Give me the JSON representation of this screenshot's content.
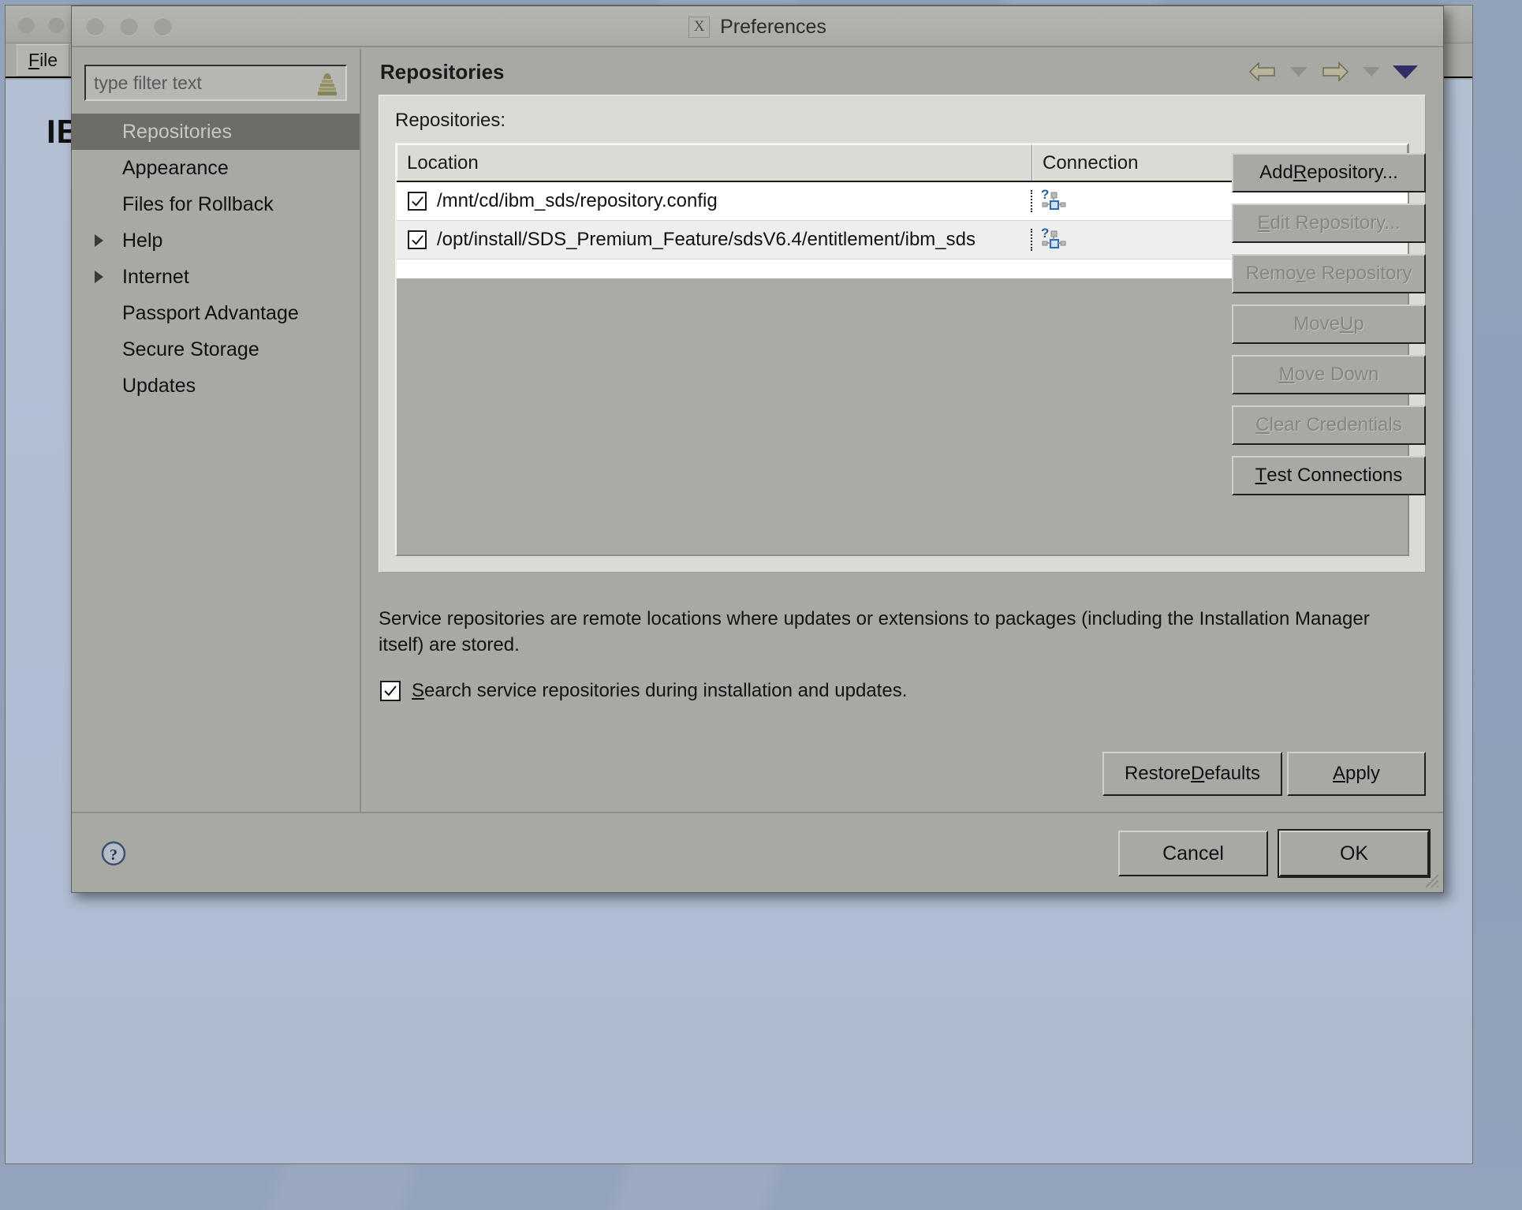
{
  "desktop": {
    "logo_alt": "IBM",
    "background_color": "#8fa0b9"
  },
  "background_window": {
    "menu": [
      {
        "label_before": "F",
        "mnemonic": "i",
        "label_after": "le",
        "full": "File"
      }
    ],
    "app_name": "IBM"
  },
  "dialog": {
    "title": "Preferences",
    "icon": "x-window-icon",
    "window_controls": [
      "close",
      "minimize",
      "maximize"
    ]
  },
  "filter": {
    "placeholder": "type filter text",
    "value": "",
    "icon": "filter-funnel-icon"
  },
  "sidebar": {
    "items": [
      {
        "label": "Repositories",
        "selected": true,
        "expandable": false
      },
      {
        "label": "Appearance",
        "selected": false,
        "expandable": false
      },
      {
        "label": "Files for Rollback",
        "selected": false,
        "expandable": false
      },
      {
        "label": "Help",
        "selected": false,
        "expandable": true
      },
      {
        "label": "Internet",
        "selected": false,
        "expandable": true
      },
      {
        "label": "Passport Advantage",
        "selected": false,
        "expandable": false
      },
      {
        "label": "Secure Storage",
        "selected": false,
        "expandable": false
      },
      {
        "label": "Updates",
        "selected": false,
        "expandable": false
      }
    ]
  },
  "panel": {
    "title": "Repositories",
    "toolbar": [
      {
        "name": "back-arrow-icon",
        "type": "arrow-left"
      },
      {
        "name": "back-dropdown-icon",
        "type": "caret"
      },
      {
        "name": "forward-arrow-icon",
        "type": "arrow-right"
      },
      {
        "name": "forward-dropdown-icon",
        "type": "caret"
      },
      {
        "name": "menu-dropdown-icon",
        "type": "caret-dark"
      }
    ]
  },
  "repositories": {
    "group_label": "Repositories:",
    "columns": [
      "Location",
      "Connection"
    ],
    "rows": [
      {
        "checked": true,
        "location": "/mnt/cd/ibm_sds/repository.config",
        "connection_icon": "unknown-connection-icon"
      },
      {
        "checked": true,
        "location": "/opt/install/SDS_Premium_Feature/sdsV6.4/entitlement/ibm_sds",
        "connection_icon": "unknown-connection-icon"
      }
    ]
  },
  "actions": [
    {
      "label": "Add Repository...",
      "pre": "Add ",
      "mnemonic": "R",
      "post": "epository...",
      "enabled": true
    },
    {
      "label": "Edit Repository...",
      "pre": "",
      "mnemonic": "E",
      "post": "dit Repository...",
      "enabled": false
    },
    {
      "label": "Remove Repository",
      "pre": "Remo",
      "mnemonic": "v",
      "post": "e Repository",
      "enabled": false
    },
    {
      "label": "Move Up",
      "pre": "Move ",
      "mnemonic": "U",
      "post": "p",
      "enabled": false
    },
    {
      "label": "Move Down",
      "pre": "",
      "mnemonic": "M",
      "post": "ove Down",
      "enabled": false
    },
    {
      "label": "Clear Credentials",
      "pre": "",
      "mnemonic": "C",
      "post": "lear Credentials",
      "enabled": false
    },
    {
      "label": "Test Connections",
      "pre": "",
      "mnemonic": "T",
      "post": "est Connections",
      "enabled": true
    }
  ],
  "description": "Service repositories are remote locations where updates or extensions to packages (including the Installation Manager itself) are stored.",
  "search_checkbox": {
    "checked": true,
    "pre": "",
    "mnemonic": "S",
    "post": "earch service repositories during installation and updates.",
    "label": "Search service repositories during installation and updates."
  },
  "panel_footer": {
    "restore": {
      "label": "Restore Defaults",
      "pre": "Restore ",
      "mnemonic": "D",
      "post": "efaults"
    },
    "apply": {
      "label": "Apply",
      "pre": "",
      "mnemonic": "A",
      "post": "pply"
    }
  },
  "dialog_footer": {
    "help_icon": "help-question-icon",
    "cancel": "Cancel",
    "ok": "OK"
  }
}
